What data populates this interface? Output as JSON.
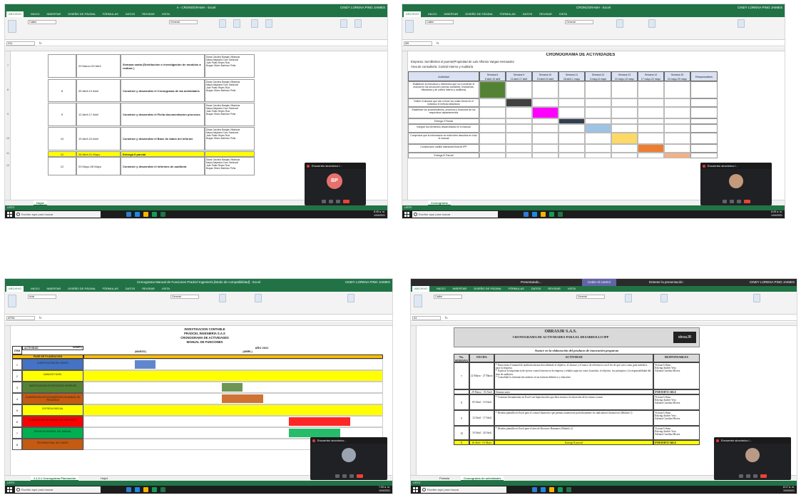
{
  "common": {
    "ribbon_tabs": [
      "ARCHIVO",
      "INICIO",
      "INSERTAR",
      "DISEÑO DE PÁGINA",
      "FÓRMULAS",
      "DATOS",
      "REVISAR",
      "VISTA"
    ],
    "search_placeholder": "Escribe aquí para buscar",
    "font_name": "Calibri",
    "number_format": "General",
    "fx": "fx",
    "brand_color": "#217346"
  },
  "panel1": {
    "window_title": "A - CRONOGRAMA - Excel",
    "user": "CINDY LORENA PINO JAIMES",
    "rows": [
      {
        "num": "7",
        "week": "",
        "dates": "29 Marzo-03 Abril",
        "activity": "Semana santa (Distribucion e investigacion de modulos a realizar )",
        "people": "Diana Carolina Barajas Villamizar\nMayra Alejandra Caro Sandoval\nJuan Pablo Reyes Ruiz\nBrayan Stiven Martinez Peña"
      },
      {
        "num": "8",
        "week": "8",
        "dates": "05 Abril-10 Abril",
        "activity": "Construir y desarrollar el Cronograma de las actividades",
        "people": "Diana Carolina Barajas Villamizar\nMayra Alejandra Caro Sandoval\nJuan Pablo Reyes Ruiz\nBrayan Stiven Martinez Peña"
      },
      {
        "num": "9",
        "week": "9",
        "dates": "12 Abril-17 Abril",
        "activity": "Construir y desarrollar el  Ficha documentacion procesos",
        "people": "Diana Carolina Barajas Villamizar\nMayra Alejandra Caro Sandoval\nJuan Pablo Reyes Ruiz\nBrayan Stiven Martinez Peña"
      },
      {
        "num": "10",
        "week": "10",
        "dates": "19 Abril-24 Abril",
        "activity": "Construir y desarrollar el Base de datos del informe",
        "people": "Diana Carolina Barajas Villamizar\nMayra Alejandra Caro Sandoval\nJuan Pablo Reyes Ruiz\nBrayan Stiven Martinez Peña"
      },
      {
        "num": "11",
        "week": "11",
        "dates": "26 Abril-01 Mayo",
        "activity": "Entrega II parcial",
        "people": ""
      },
      {
        "num": "12",
        "week": "12",
        "dates": "03 Mayo-08 Mayo",
        "activity": "Construir y desarrollar el informes de auditoria",
        "people": "Diana Carolina Barajas Villamizar\nMayra Alejandra Caro Sandoval\nJuan Pablo Reyes Ruiz\nBrayan Stiven Martinez Peña"
      }
    ],
    "sheet_tab": "Hoja1",
    "meet_title": "Encuentro sincrónico l...",
    "meet_initials": "BP",
    "time": "8:45 a. m.",
    "date": "1/04/2021"
  },
  "panel2": {
    "window_title": "CRONOGRAMA - Excel",
    "user": "CINDY LORENA PINO JAIMES",
    "title": "CRONOGRAMA DE ACTIVIDADES",
    "empresa": "Empresa: Semilleritos el puente(Propiedad de Luis Alfonso Vargas Hernandez",
    "area": "Área de consultoría: Control Interno y Auditoría",
    "col_activity": "Actividad",
    "col_resp": "Responsables",
    "weeks": [
      {
        "label": "Semana 8",
        "dates": "5 abril-10 abril",
        "color": "#548235"
      },
      {
        "label": "Semana 9",
        "dates": "12 abril-17 abril",
        "color": "#404040"
      },
      {
        "label": "Semana 10",
        "dates": "19 abril-24 abril",
        "color": "#ff00ff"
      },
      {
        "label": "Semana 11",
        "dates": "26 abril-1 mayo",
        "color": "#333f50"
      },
      {
        "label": "Semana 12",
        "dates": "3 mayo-8 mayo",
        "color": "#9dc3e6"
      },
      {
        "label": "Semana 13",
        "dates": "10 mayo-15 mayo",
        "color": "#ffd966"
      },
      {
        "label": "Semana 14",
        "dates": "17 mayo-22 mayo",
        "color": "#ed7d31"
      },
      {
        "label": "Semana 15",
        "dates": "24 mayo-29 mayo",
        "color": "#f4b183"
      }
    ],
    "activities": [
      "Establecer la estructura y elementos que va a contener el manual en las secciones (normas contables, financieras, tributarias y de control interno y auditoría)",
      "Definir el alcance que van a tener los cuatro items en el individuo el método didácticos",
      "Establecer los procedimientos, procesos y funciones de los respectivos departamentos",
      "Entrega II Parcial",
      "Integrar los elementos desarrollados en el manual",
      "Comprobar que la información se estén bien descritos en todo el manual",
      "Construcción cartilla Interactiva final de IPP",
      "Entrega III Parcial"
    ],
    "sheet_tab": "Cronograma",
    "meet_title": "Encuentro sincrónico l...",
    "time": "8:45 a. m.",
    "date": "1/04/2021"
  },
  "panel3": {
    "window_title": "Cronograma Manual de Funciones Pradcel Ingeniería  [Modo de compatibilidad] - Excel",
    "user": "CINDY LORENA PINO JAIMES",
    "font_name": "Arial",
    "cell_ref": "AF5A",
    "header_lines": [
      "INVESTIGACION CONTABLE",
      "PRADCEL INGENIERIA S.A.S",
      "CRONOGRAMA DE ACTIVIDADES",
      "MANUAL DE FUNCIONES"
    ],
    "year": "AÑO 2021",
    "tiempo": "TIEMPO",
    "item": "ITEM",
    "actividad": "ACTIVIDAD",
    "phase": "FASE DE PLANEACION",
    "months": [
      "(MARZO)",
      "(ABRIL)"
    ],
    "rows": [
      {
        "item": "1",
        "text": "CONSTITUCION DEL GRUPO",
        "color": "#4472c4"
      },
      {
        "item": "2",
        "text": "MANDATO NIVEL",
        "color": "#ffff00"
      },
      {
        "item": "3",
        "text": "INVESTIGACION DE PROCESOS INTERNOS",
        "color": "#548235"
      },
      {
        "item": "4",
        "text": "ELABORACION DE DOCUMENTACION MANUAL DE PROCESOS",
        "color": "#c55a11"
      },
      {
        "item": "5",
        "text": "ENTREGA PARCIAL",
        "color": "#ffff00"
      },
      {
        "item": "6",
        "text": "ELABORACION DE MANUAL DE FUNCIONES",
        "color": "#ff0000"
      },
      {
        "item": "7",
        "text": "REVISION GENERAL DEL MANUAL",
        "color": "#00b050"
      },
      {
        "item": "8",
        "text": "REVISION FINAL DE COMITE",
        "color": "#c55a11"
      }
    ],
    "sheet_tabs": [
      "1.1.2.1 Cronograma Planeación",
      "Hoja1"
    ],
    "meet_title": "Encuentro sincrónico...",
    "time": "7:05 a. m.",
    "date": "1/04/2021"
  },
  "panel4": {
    "present_bar": {
      "status": "Presentando...",
      "control": "Ceder el control",
      "stop": "Detener la presentación"
    },
    "user": "CINDY LORENA PINO JAIMES",
    "font_name": "Calibri",
    "cell_ref": "A1",
    "company": "OBRASJR S.A.S.",
    "subtitle": "CRONOGRAMA DE ACTIVIDADES PARA EL DESARROLLO IPP",
    "avance": "Avance en la elaboración del producto de innovación propuesto",
    "headers": [
      "No. SEMANA",
      "FECHA",
      "ACTIVIDAD",
      "RESPONSABLES"
    ],
    "logo_text": "obrasJR",
    "rows": [
      {
        "week": "7",
        "date": "22 Marzo - 27 Marzo",
        "activity": "* Estructurar el manual de auditoría interna describiendo el objetivo, el alcance y el marco de referencia con el fin de que sirva como guía metódica para la empresa.\n* Explicar la importancia de ejercer control interno en la empresa y señalar aspectos como la misión, el objetivo, los principios y la responsabilidad del área de auditoría.\n* Consolidar la información anterior en un formato didáctico y educativo",
        "resp": "Viviana Urbina\nEdwing Andrés Vera\nAdriana Carolina Rivera",
        "fill": ""
      },
      {
        "week": "",
        "date": "29 Marzo - 03 Abril",
        "activity": "Semana santa",
        "resp": "INMODIFICABLE",
        "fill": ""
      },
      {
        "week": "8",
        "date": "05 Abril - 10 Abril",
        "activity": "* Construir herramientas en Excel con hipervínculos que direccionen a la ubicación de los temas a tratar",
        "resp": "Viviana Urbina\nEdwing Andrés Vera\nAdriana Carolina Rivera",
        "fill": ""
      },
      {
        "week": "9",
        "date": "12 Abril - 17 Abril",
        "activity": "* Diseñar plantilla en Excel para el control financiero que permita monitorear periódicamente los indicadores financieros (Módulo 1)",
        "resp": "Viviana Urbina\nEdwing Andrés Vera\nAdriana Carolina Rivera",
        "fill": ""
      },
      {
        "week": "10",
        "date": "19 Abril - 24 Abril",
        "activity": "* Diseñar plantilla en Excel para el área de Recursos Humanos (Módulo 2)",
        "resp": "Viviana Urbina\nEdwing Andrés Vera\nAdriana Carolina Rivera",
        "fill": ""
      },
      {
        "week": "11",
        "date": "26 Abril - 01 Mayo",
        "activity": "Entrega II parcial",
        "resp": "INMODIFICABLE",
        "fill": "#ffff00"
      }
    ],
    "sheet_tabs": [
      "Portada",
      "Cronograma de actividades"
    ],
    "meet_title": "Encuentro sincrónico l...",
    "time": "8:17 a. m.",
    "date": "1/04/2021"
  }
}
